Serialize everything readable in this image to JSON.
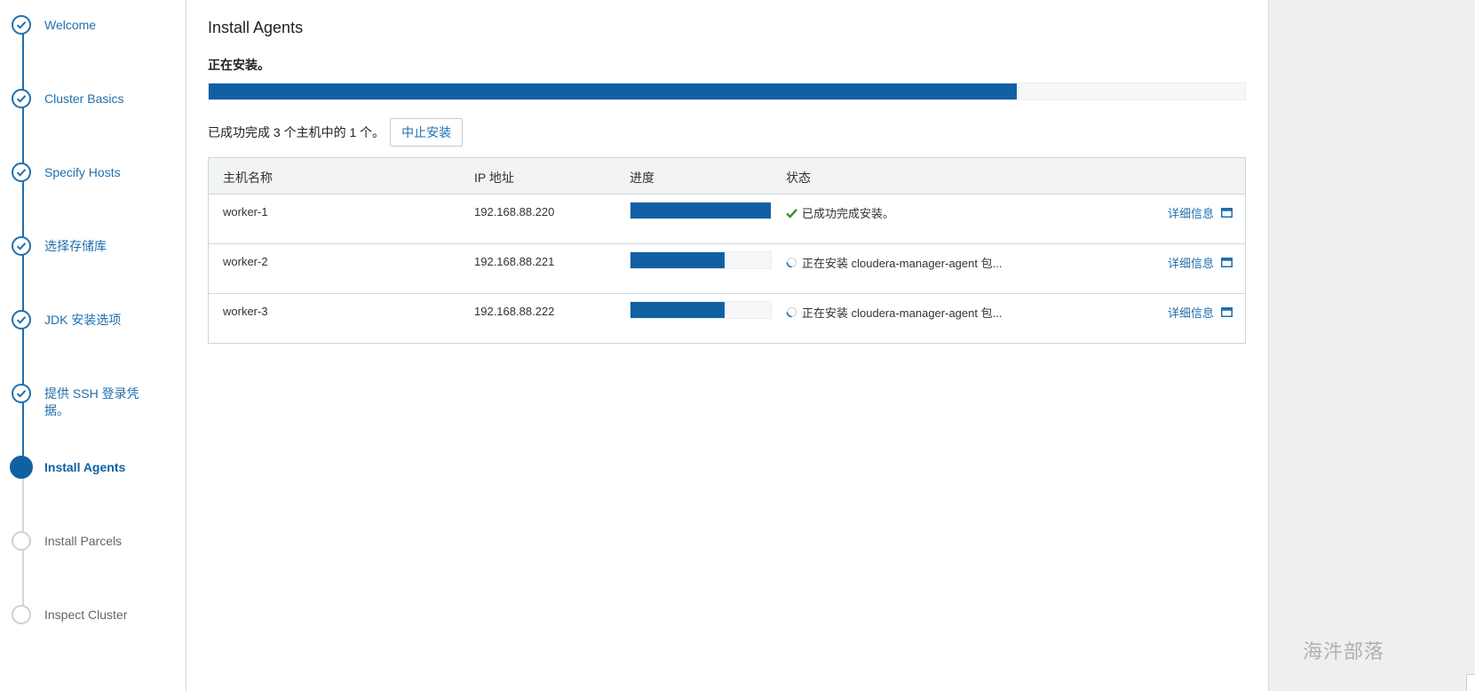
{
  "sidebar": {
    "steps": [
      {
        "label": "Welcome",
        "state": "done"
      },
      {
        "label": "Cluster Basics",
        "state": "done"
      },
      {
        "label": "Specify Hosts",
        "state": "done"
      },
      {
        "label": "选择存储库",
        "state": "done"
      },
      {
        "label": "JDK 安装选项",
        "state": "done"
      },
      {
        "label": "提供 SSH 登录凭据。",
        "state": "done"
      },
      {
        "label": "Install Agents",
        "state": "active"
      },
      {
        "label": "Install Parcels",
        "state": "pending"
      },
      {
        "label": "Inspect Cluster",
        "state": "pending"
      }
    ]
  },
  "main": {
    "title": "Install Agents",
    "installing_label": "正在安装。",
    "overall_progress": 0.78,
    "summary": "已成功完成 3 个主机中的 1 个。",
    "abort_button": "中止安装",
    "table": {
      "headers": {
        "host": "主机名称",
        "ip": "IP 地址",
        "progress": "进度",
        "status": "状态"
      },
      "rows": [
        {
          "host": "worker-1",
          "ip": "192.168.88.220",
          "progress": 1.0,
          "status": "已成功完成安装。",
          "status_icon": "check-icon",
          "details": "详细信息"
        },
        {
          "host": "worker-2",
          "ip": "192.168.88.221",
          "progress": 0.67,
          "status": "正在安装 cloudera-manager-agent 包...",
          "status_icon": "spinner-icon",
          "details": "详细信息"
        },
        {
          "host": "worker-3",
          "ip": "192.168.88.222",
          "progress": 0.67,
          "status": "正在安装 cloudera-manager-agent 包...",
          "status_icon": "spinner-icon",
          "details": "详细信息"
        }
      ]
    }
  },
  "right_panel": {
    "watermark": "海汼部落"
  },
  "colors": {
    "accent": "#1160a4",
    "link": "#1f6fae",
    "success": "#3c8d2f"
  }
}
